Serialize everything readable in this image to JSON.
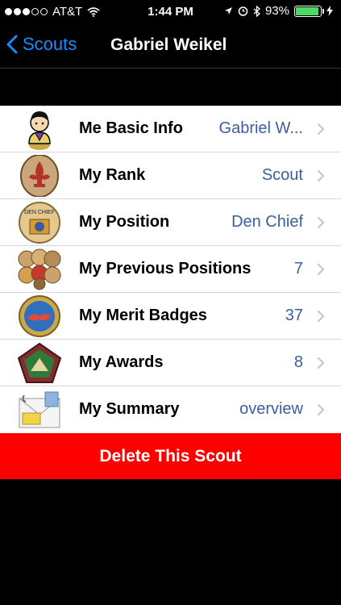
{
  "status_bar": {
    "carrier": "AT&T",
    "time": "1:44 PM",
    "battery_percent": "93%",
    "battery_level": 0.93,
    "icons": [
      "signal-dots-icon",
      "wifi-icon",
      "location-arrow-icon",
      "alarm-icon",
      "bluetooth-icon",
      "battery-icon",
      "charging-bolt-icon"
    ]
  },
  "nav": {
    "back_label": "Scouts",
    "title": "Gabriel Weikel"
  },
  "rows": [
    {
      "label": "Me Basic Info",
      "value": "Gabriel W...",
      "icon": "scout-avatar-icon"
    },
    {
      "label": "My Rank",
      "value": "Scout",
      "icon": "rank-badge-icon"
    },
    {
      "label": "My Position",
      "value": "Den Chief",
      "icon": "den-chief-patch-icon"
    },
    {
      "label": "My Previous Positions",
      "value": "7",
      "icon": "patches-collection-icon"
    },
    {
      "label": "My Merit Badges",
      "value": "37",
      "icon": "merit-badge-icon"
    },
    {
      "label": "My Awards",
      "value": "8",
      "icon": "awards-patch-icon"
    },
    {
      "label": "My Summary",
      "value": "overview",
      "icon": "summary-envelope-icon"
    }
  ],
  "delete_label": "Delete This Scout",
  "colors": {
    "accent_blue": "#1a8cff",
    "value_blue": "#3a5f9c",
    "delete_red": "#ff0000",
    "battery_green": "#4cd964"
  },
  "patch_text": {
    "den_chief": "DEN CHIEF"
  }
}
